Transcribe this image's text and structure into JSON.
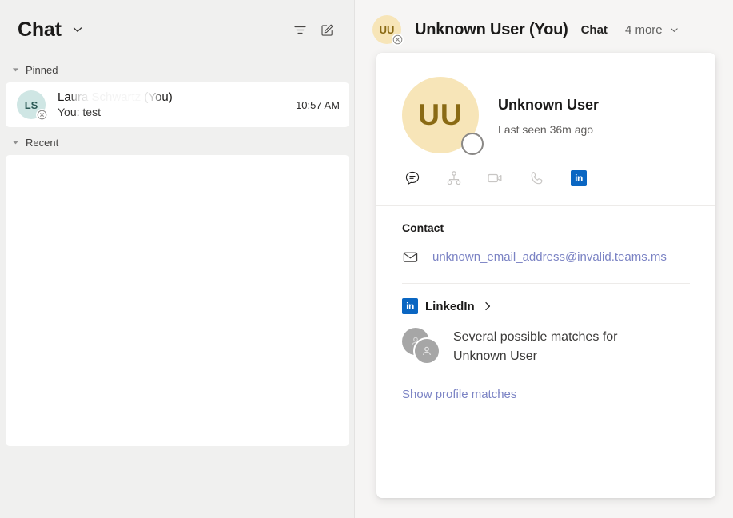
{
  "left_pane": {
    "title": "Chat",
    "title_chevron_icon": "chevron-down-icon",
    "filter_icon": "filter-icon",
    "compose_icon": "compose-new-chat-icon",
    "sections": [
      {
        "label": "Pinned"
      },
      {
        "label": "Recent"
      }
    ],
    "pinned_chat": {
      "avatar_initials": "LS",
      "avatar_color": "#cfe6e4",
      "status_badge_icon": "unknown-presence-icon",
      "name": "Laura Schwartz (You)",
      "preview": "You: test",
      "time": "10:57 AM"
    }
  },
  "right_pane": {
    "header": {
      "avatar_initials": "UU",
      "avatar_color": "#f7e5b8",
      "status_badge_icon": "unknown-presence-icon",
      "title": "Unknown User (You)",
      "active_tab": "Chat",
      "more_tabs": "4 more",
      "more_chevron_icon": "chevron-down-icon"
    },
    "profile_card": {
      "avatar_initials": "UU",
      "avatar_color": "#f7e5b8",
      "presence_icon": "offline-ring-icon",
      "name": "Unknown User",
      "status": "Last seen 36m ago",
      "actions": [
        {
          "name": "chat-action",
          "icon": "chat-bubble-icon",
          "state": "dark"
        },
        {
          "name": "org-chart-action",
          "icon": "org-chart-icon",
          "state": "dim"
        },
        {
          "name": "video-call-action",
          "icon": "video-camera-icon",
          "state": "dim"
        },
        {
          "name": "audio-call-action",
          "icon": "phone-icon",
          "state": "dim"
        },
        {
          "name": "linkedin-action",
          "icon": "linkedin-icon",
          "state": "brand"
        }
      ],
      "contact": {
        "heading": "Contact",
        "mail_icon": "envelope-icon",
        "email": "unknown_email_address@invalid.teams.ms",
        "email_color": "#7b83c4"
      },
      "linkedin": {
        "brand_icon": "linkedin-icon",
        "brand_label": "LinkedIn",
        "arrow_icon": "chevron-right-icon",
        "match_avatars_icon": "people-group-icon",
        "match_text": "Several possible matches for Unknown User",
        "show_matches_label": "Show profile matches",
        "link_color": "#7b83c4",
        "brand_color": "#0a66c2"
      }
    }
  }
}
